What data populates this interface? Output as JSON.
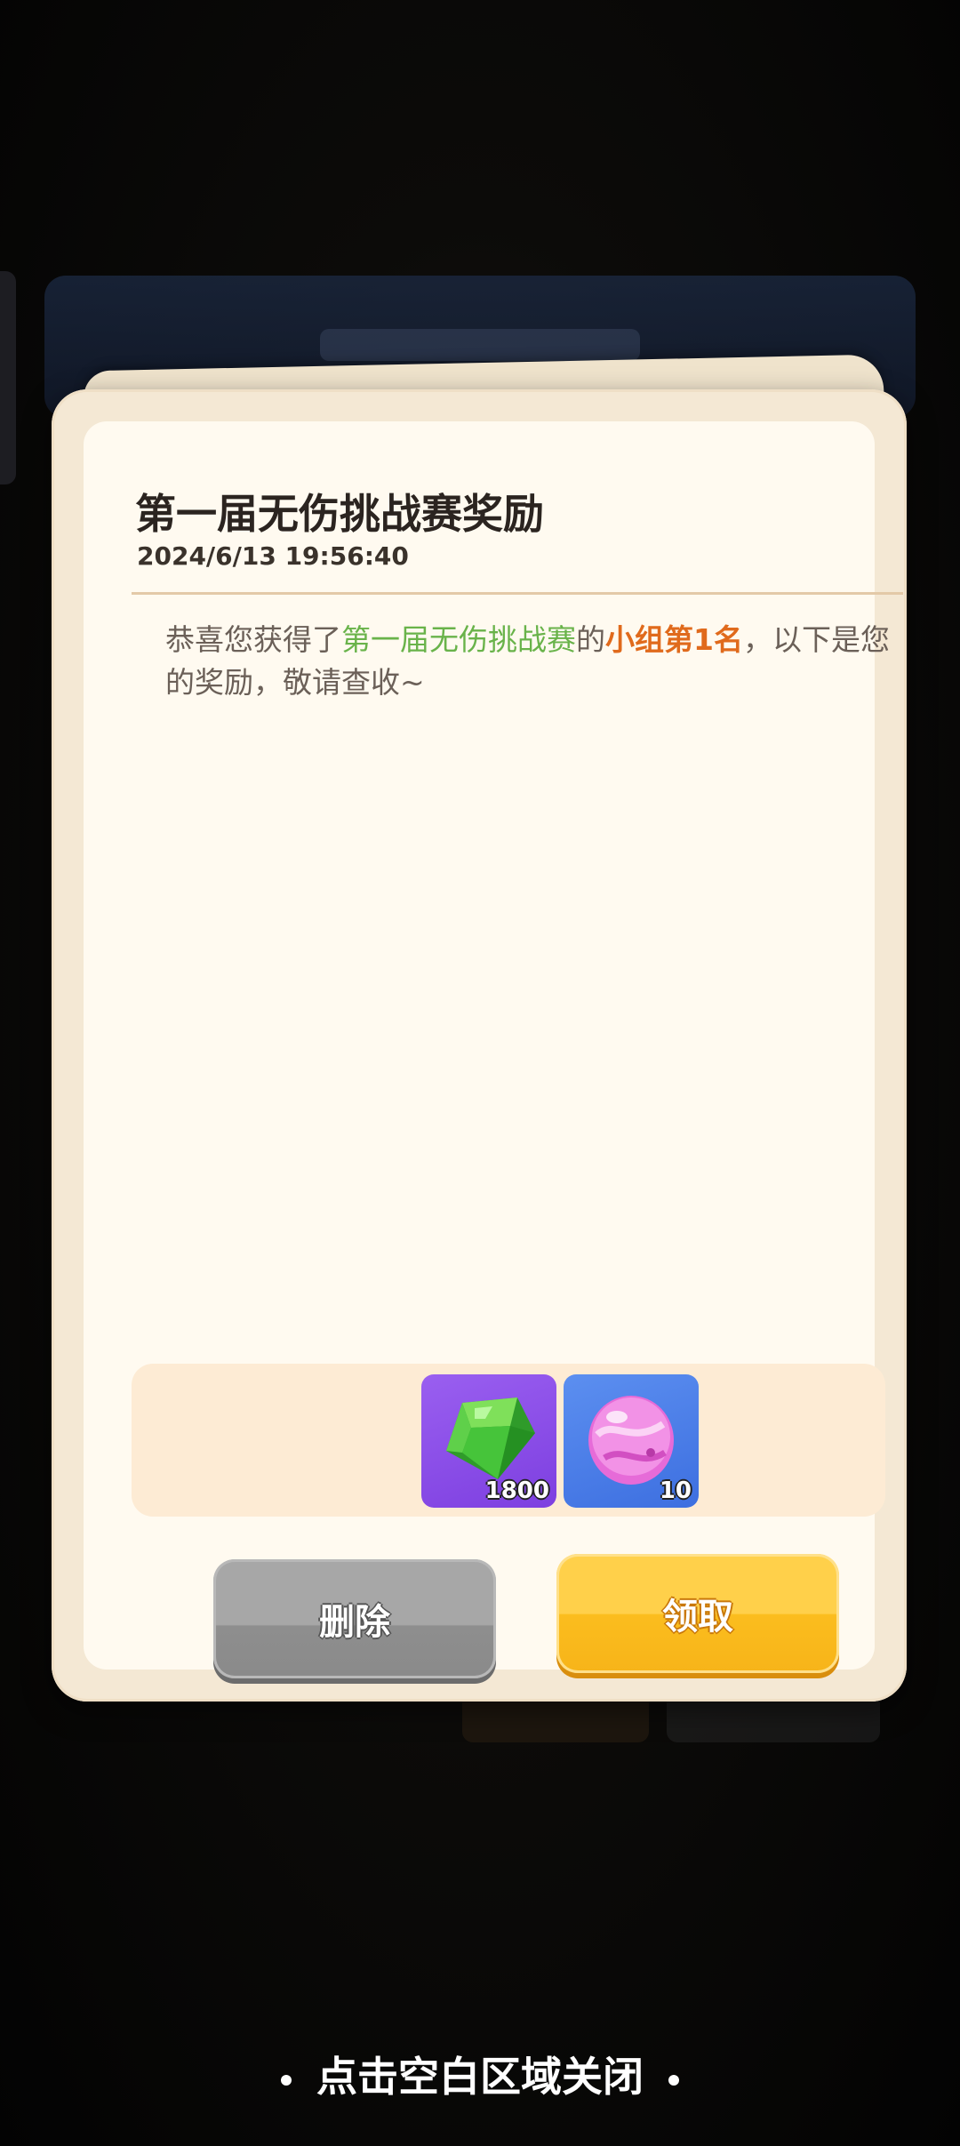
{
  "mail": {
    "title": "第一届无伤挑战赛奖励",
    "date": "2024/6/13 19:56:40",
    "message": {
      "prefix": "恭喜您获得了",
      "event_name": "第一届无伤挑战赛",
      "mid": "的",
      "rank": "小组第1名",
      "suffix": "，以下是您的奖励，敬请查收~"
    },
    "colors": {
      "event_name": "#69b34a",
      "rank": "#e06a1c"
    }
  },
  "rewards": [
    {
      "icon": "green-gem-icon",
      "count": "1800"
    },
    {
      "icon": "pink-egg-icon",
      "count": "10"
    }
  ],
  "buttons": {
    "delete_label": "删除",
    "claim_label": "领取"
  },
  "close_hint": "点击空白区域关闭"
}
